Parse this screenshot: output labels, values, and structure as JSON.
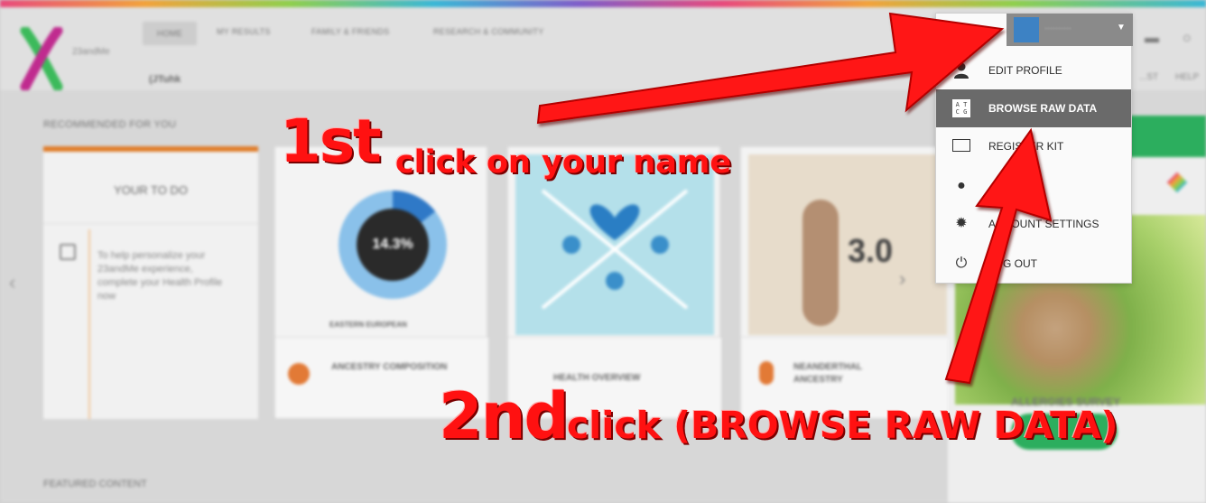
{
  "nav": {
    "tabs": [
      "HOME",
      "MY RESULTS",
      "FAMILY & FRIENDS",
      "RESEARCH & COMMUNITY"
    ],
    "username": "(JTuhk",
    "right_links": [
      "...ST",
      "HELP"
    ]
  },
  "recommended": {
    "title": "RECOMMENDED FOR YOU",
    "todo_title": "YOUR TO DO",
    "todo_text": "To help personalize your 23andMe experience, complete your Health Profile now",
    "cards": [
      {
        "figure": "14.3%",
        "caption": "EASTERN EUROPEAN",
        "footer": "ANCESTRY COMPOSITION"
      },
      {
        "footer": "HEALTH OVERVIEW"
      },
      {
        "figure": "3.0",
        "footer": "NEANDERTHAL ANCESTRY"
      }
    ]
  },
  "sidebar": {
    "title": "ALLERGIES SURVEY"
  },
  "featured": {
    "title": "FEATURED CONTENT"
  },
  "user_menu": {
    "items": [
      {
        "icon": "person-icon",
        "label": "EDIT PROFILE"
      },
      {
        "icon": "atcg-icon",
        "label": "BROWSE RAW DATA",
        "active": true
      },
      {
        "icon": "monitor-icon",
        "label": "REGISTER KIT"
      },
      {
        "icon": "globe-icon",
        "label": ""
      },
      {
        "icon": "gear-icon",
        "label": "ACCOUNT SETTINGS"
      },
      {
        "icon": "power-icon",
        "label": "LOG OUT"
      }
    ]
  },
  "annotations": {
    "step1_big": "1st",
    "step1_small": "click on your name",
    "step2_big": "2nd",
    "step2_small": "click (BROWSE RAW DATA)"
  },
  "colors": {
    "annotation_red": "#ff1111",
    "accent_green": "#2cae5e",
    "accent_orange": "#e07d2b",
    "menu_active": "#6a6a6a"
  }
}
